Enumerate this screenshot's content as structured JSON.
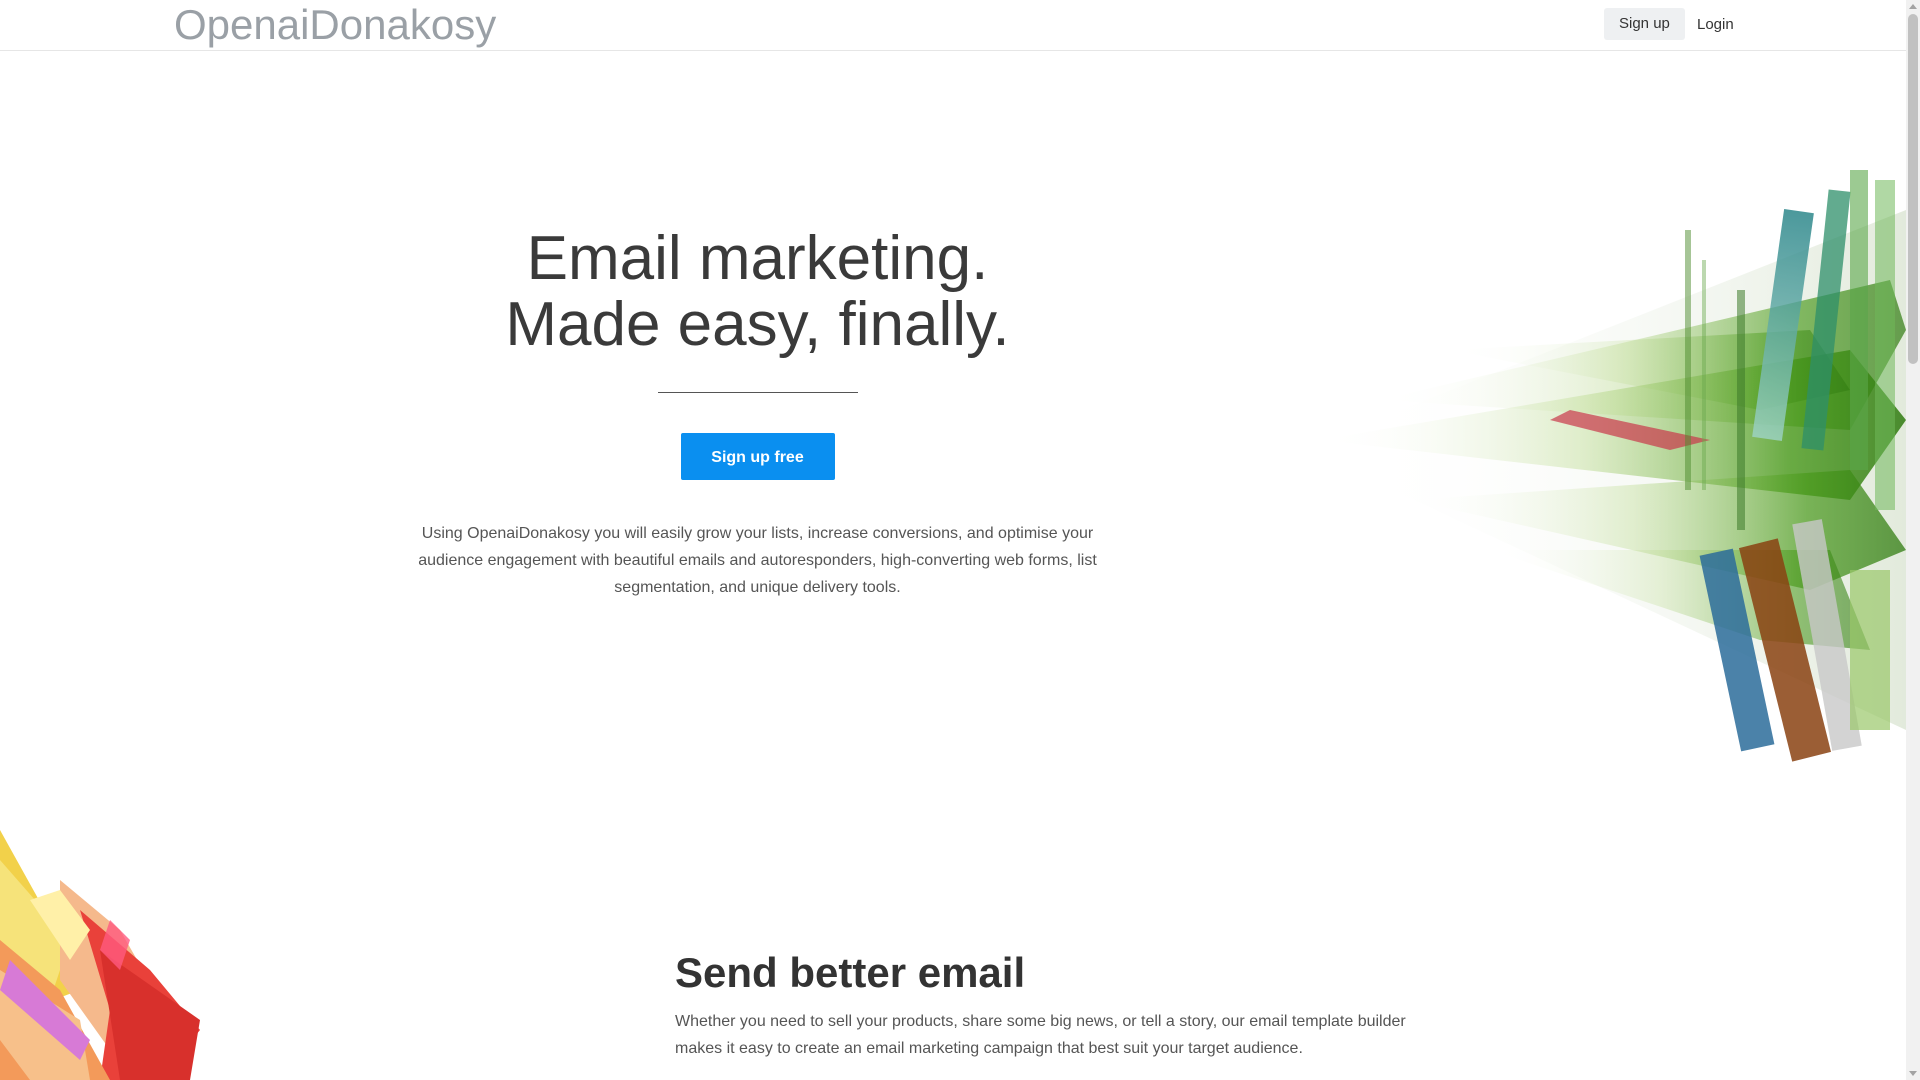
{
  "header": {
    "logo": "OpenaiDonakosy",
    "signup_label": "Sign up",
    "login_label": "Login"
  },
  "hero": {
    "title_line1": "Email marketing.",
    "title_line2": "Made easy, finally.",
    "cta_label": "Sign up free",
    "description": "Using OpenaiDonakosy you will easily grow your lists, increase conversions, and optimise your audience engagement with beautiful emails and autoresponders, high-converting web forms, list segmentation, and unique delivery tools."
  },
  "section2": {
    "heading": "Send better email",
    "description": "Whether you need to sell your products, share some big news, or tell a story, our email template builder makes it easy to create an email marketing campaign that best suit your target audience."
  },
  "colors": {
    "cta": "#0a8ff0",
    "logo": "#9aa0a6",
    "border": "#e6e6e6"
  }
}
